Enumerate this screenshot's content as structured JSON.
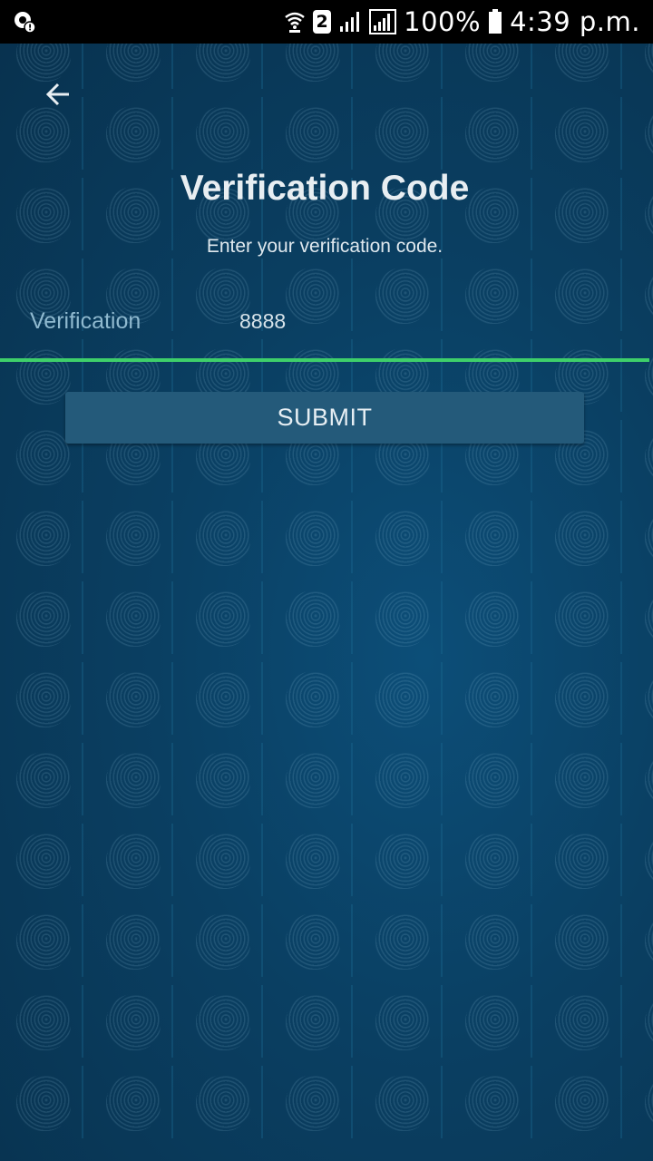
{
  "status_bar": {
    "left_icon": "shield-alert-icon",
    "sim_badge": "2",
    "battery_percent": "100%",
    "time": "4:39 p.m.",
    "icons": [
      "wifi-icon",
      "sim-badge",
      "signal-icon",
      "signal-boxed-icon",
      "battery-icon"
    ]
  },
  "header": {
    "back_icon": "arrow-left-icon",
    "title": "Verification Code",
    "subtitle": "Enter your verification code."
  },
  "form": {
    "verification_label": "Verification",
    "verification_value": "8888",
    "submit_label": "SUBMIT"
  },
  "colors": {
    "background": "#0a3f62",
    "accent_underline": "#3ecf6a",
    "button": "#245a7a",
    "label": "#8fb9cf",
    "status_bar": "#000000"
  }
}
